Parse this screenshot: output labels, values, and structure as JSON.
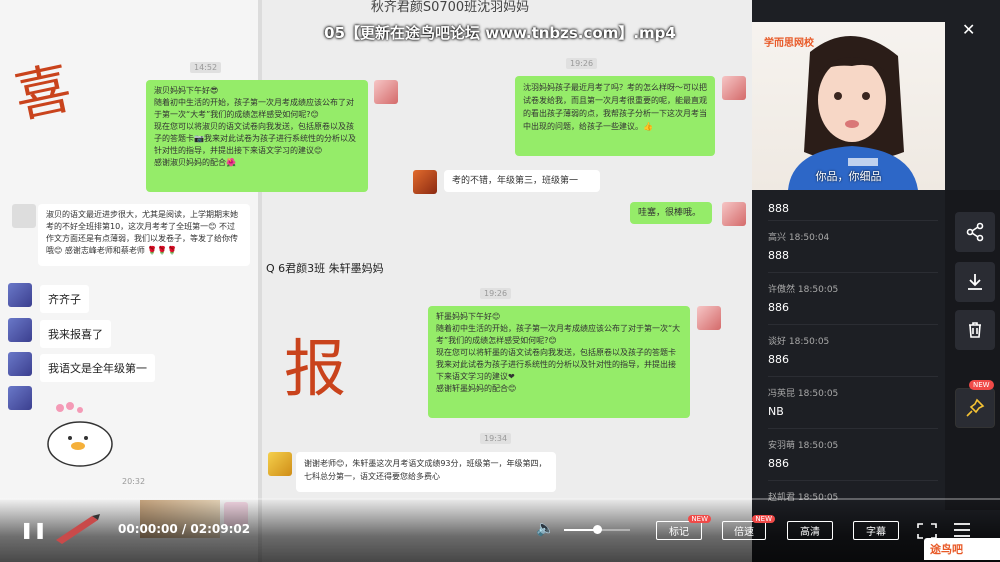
{
  "top_title": "秋齐君颜S0700班沈羽妈妈",
  "watermark": "05【更新在途鸟吧论坛 www.tnbzs.com】.mp4",
  "window_controls": {
    "pin": "⊤",
    "minimize": "—",
    "maximize": "☐",
    "close": "✕"
  },
  "webcam": {
    "logo": "学而思网校",
    "caption": "你品，你细品"
  },
  "chat": {
    "times": [
      "14:52",
      "19:26",
      "19:26",
      "19:34"
    ],
    "msg1": "淑贝妈妈下午好😎\n随着初中生活的开始，孩子第一次月考成绩应该公布了对于第一次“大考”我们的成绩怎样感受如何呢?😊\n现在您可以将淑贝的语文试卷向我发送，包括原卷以及孩子的答题卡📷我来对此试卷为孩子进行系统性的分析以及针对性的指导，并提出接下来语文学习的建议😊\n感谢淑贝妈妈的配合🌺",
    "msg2": "沈羽妈妈孩子最近月考了吗？考的怎么样呀～可以把试卷发给我，而且第一次月考很重要的呢，能最直观的看出孩子薄弱的点，我帮孩子分析一下这次月考当中出现的问题，给孩子一些建议。👍",
    "msg3": "考的不错，年级第三，班级第一",
    "msg4": "哇塞，很棒哦。",
    "msg5": "淑贝的语文最近进步很大，尤其是阅读，上学期期末她考的不好全班排第10，这次月考考了全班第一😊 不过作文方面还是有点薄弱，我们以发卷子，等发了给你传哦😊 感谢志峰老师和蔡老师 🌹🌹🌹",
    "group_name": "Q 6君颜3班 朱轩墨妈妈",
    "msg6": "轩墨妈妈下午好😊\n随着初中生活的开始，孩子第一次月考成绩应该公布了对于第一次“大考”我们的成绩怎样感受如何呢?😊\n现在您可以将轩墨的语文试卷向我发送，包括原卷以及孩子的答题卡我来对此试卷为孩子进行系统性的分析以及针对性的指导，并提出接下来语文学习的建议❤\n感谢轩墨妈妈的配合😊",
    "msg7": "谢谢老师😊，朱轩墨这次月考语文成绩93分，班级第一，年级第四，七科总分第一，语文还得要您给多费心",
    "handwriting_1": "喜",
    "handwriting_2": "报",
    "left_msgs": [
      "齐齐子",
      "我来报喜了",
      "我语文是全年级第一"
    ],
    "left_time": "20:32"
  },
  "comments": [
    {
      "name": "",
      "text": "888"
    },
    {
      "name": "高兴 18:50:04",
      "text": "888"
    },
    {
      "name": "许傲然 18:50:05",
      "text": "886"
    },
    {
      "name": "谈好 18:50:05",
      "text": "886"
    },
    {
      "name": "冯英昆 18:50:05",
      "text": "NB"
    },
    {
      "name": "安羽萌 18:50:05",
      "text": "886"
    },
    {
      "name": "赵凯君 18:50:05",
      "text": ""
    }
  ],
  "sidebar": {
    "new_label": "NEW"
  },
  "player": {
    "time": "00:00:00 / 02:09:02",
    "progress": 0,
    "volume": 0.5,
    "btn_notes": "标记",
    "btn_speed": "倍速",
    "btn_quality": "高清",
    "btn_subs": "字幕",
    "new": "NEW"
  },
  "corner_logo": "途鸟吧",
  "colors": {
    "accent": "#f04a48",
    "green_bubble": "#95ec69"
  }
}
